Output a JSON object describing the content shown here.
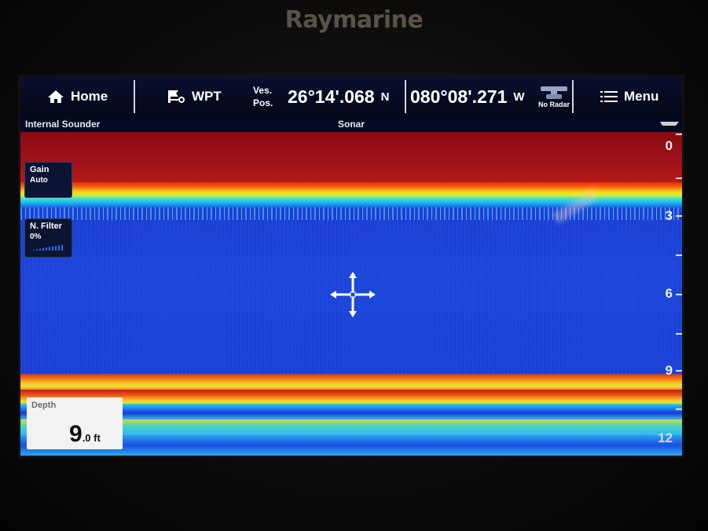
{
  "brand": "Raymarine",
  "topbar": {
    "home_label": "Home",
    "wpt_label": "WPT",
    "vespos_line1": "Ves.",
    "vespos_line2": "Pos.",
    "latitude": "26°14'.068",
    "lat_hemisphere": "N",
    "longitude": "080°08'.271",
    "lon_hemisphere": "W",
    "radar_status": "No Radar",
    "menu_label": "Menu"
  },
  "subbar": {
    "source": "Internal Sounder",
    "mode": "Sonar"
  },
  "gain": {
    "label": "Gain",
    "value": "Auto"
  },
  "noise_filter": {
    "label": "N. Filter",
    "value": "0%"
  },
  "depth": {
    "label": "Depth",
    "value": "9",
    "unit": ".0 ft"
  },
  "scale": {
    "labels": [
      "0",
      "3",
      "6",
      "9",
      "12"
    ]
  },
  "icons": [
    "home-icon",
    "waypoint-icon",
    "radar-icon",
    "menu-icon",
    "boat-icon",
    "crosshair-icon"
  ],
  "colors": {
    "surface_red": "#a3141a",
    "water_blue": "#1d45d8",
    "bottom_yellow": "#f7c622"
  }
}
